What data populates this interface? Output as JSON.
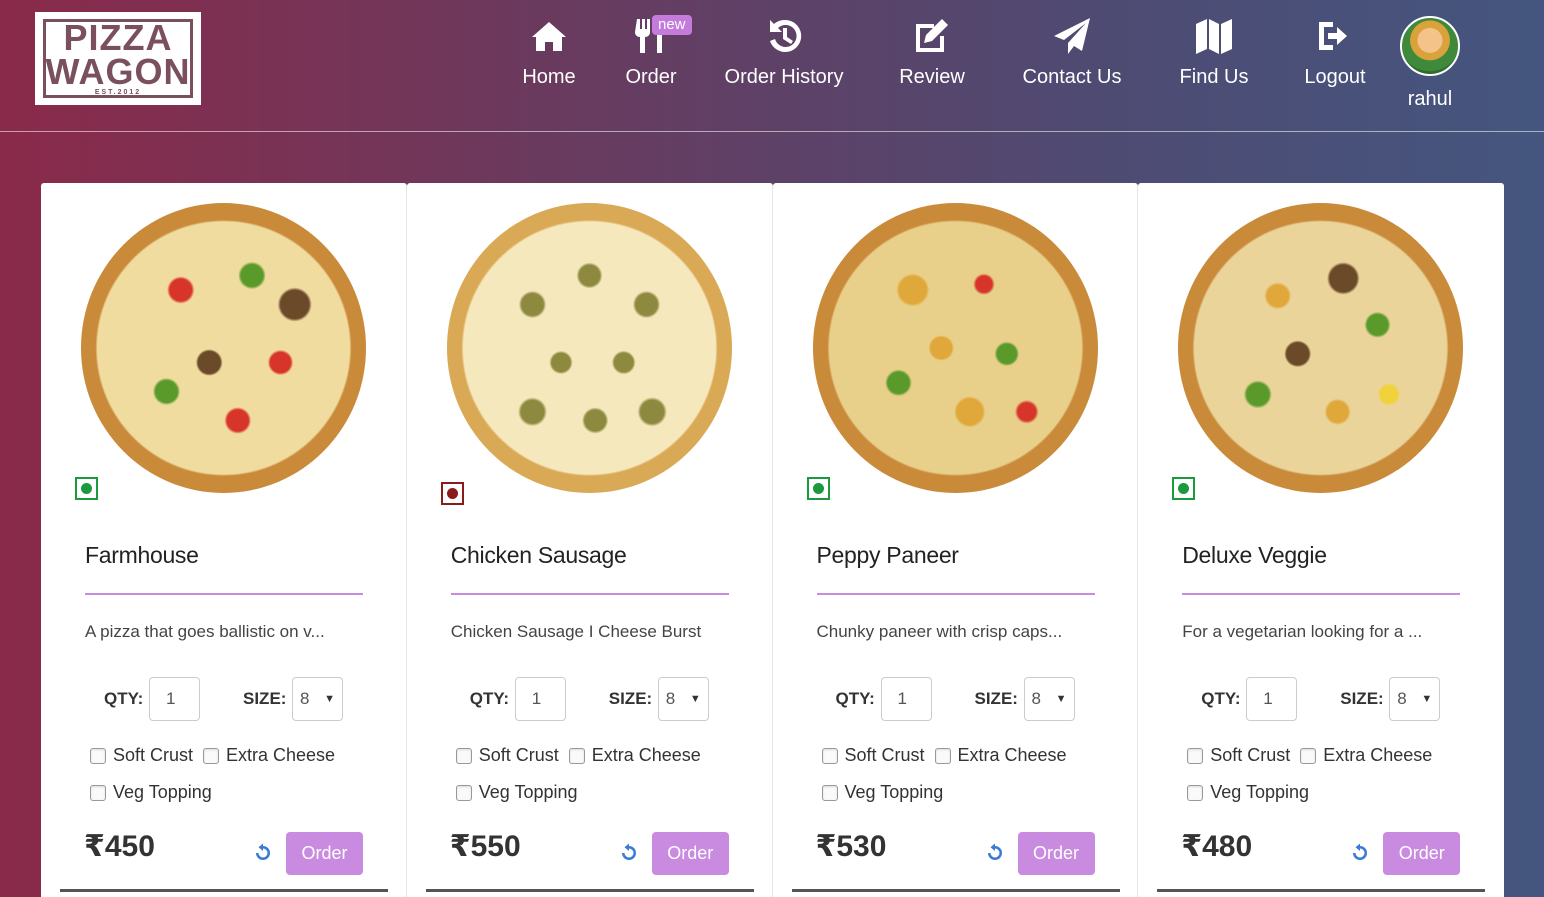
{
  "brand": {
    "line1": "PIZZA",
    "line2": "WAGON",
    "est": "EST.2012"
  },
  "nav": {
    "items": [
      {
        "label": "Home",
        "icon": "home-icon"
      },
      {
        "label": "Order",
        "icon": "cutlery-icon",
        "badge": "new"
      },
      {
        "label": "Order History",
        "icon": "history-icon"
      },
      {
        "label": "Review",
        "icon": "edit-icon"
      },
      {
        "label": "Contact Us",
        "icon": "send-icon"
      },
      {
        "label": "Find Us",
        "icon": "map-icon"
      },
      {
        "label": "Logout",
        "icon": "logout-icon"
      }
    ],
    "user": "rahul"
  },
  "labels": {
    "qty": "QTY:",
    "size": "SIZE:",
    "soft_crust": "Soft Crust",
    "extra_cheese": "Extra Cheese",
    "veg_topping": "Veg Topping",
    "order": "Order"
  },
  "colors": {
    "accent": "#c98be0",
    "veg": "#1a9a3c",
    "nonveg": "#8b1a1a"
  },
  "products": [
    {
      "name": "Farmhouse",
      "description": "A pizza that goes ballistic on v...",
      "qty": "1",
      "size": "8",
      "price": "₹450",
      "type": "veg"
    },
    {
      "name": "Chicken Sausage",
      "description": "Chicken Sausage I Cheese Burst",
      "qty": "1",
      "size": "8",
      "price": "₹550",
      "type": "nonveg"
    },
    {
      "name": "Peppy Paneer",
      "description": "Chunky paneer with crisp caps...",
      "qty": "1",
      "size": "8",
      "price": "₹530",
      "type": "veg"
    },
    {
      "name": "Deluxe Veggie",
      "description": "For a vegetarian looking for a ...",
      "qty": "1",
      "size": "8",
      "price": "₹480",
      "type": "veg"
    }
  ]
}
